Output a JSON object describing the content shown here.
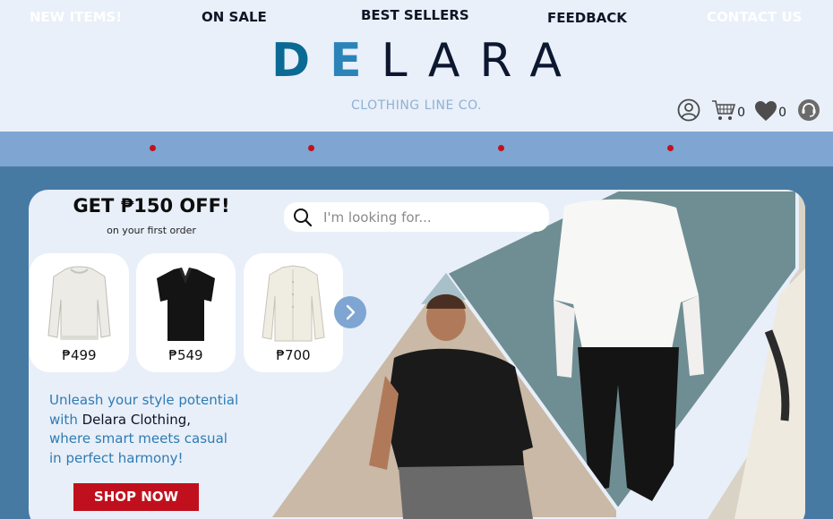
{
  "header": {
    "logo": {
      "part1": "D",
      "part2": "E",
      "part3": "LARA"
    },
    "tagline": "CLOTHING LINE CO.",
    "cart_count": "0",
    "wishlist_count": "0"
  },
  "nav": {
    "items": [
      {
        "label": "NEW ITEMS!"
      },
      {
        "label": "ON SALE"
      },
      {
        "label": "BEST SELLERS"
      },
      {
        "label": "FEEDBACK"
      },
      {
        "label": "CONTACT US"
      }
    ]
  },
  "promo": {
    "title": "GET ₱150 OFF!",
    "subtitle": "on your first order"
  },
  "search": {
    "placeholder": "I'm looking for..."
  },
  "products": [
    {
      "price": "₱499",
      "icon": "sweater"
    },
    {
      "price": "₱549",
      "icon": "polo-shirt"
    },
    {
      "price": "₱700",
      "icon": "long-sleeve-shirt"
    }
  ],
  "hero_text": {
    "line1": "Unleash your style potential",
    "line2_pre": "with ",
    "line2_brand": "Delara Clothing",
    "line2_post": ",",
    "line3": "where smart meets casual",
    "line4": "in perfect harmony!"
  },
  "cta": {
    "label": "SHOP NOW"
  },
  "colors": {
    "accent_blue": "#7fa5d2",
    "background_blue": "#477aa3",
    "cta_red": "#c0101d",
    "light_bg": "#e9f0f9"
  }
}
